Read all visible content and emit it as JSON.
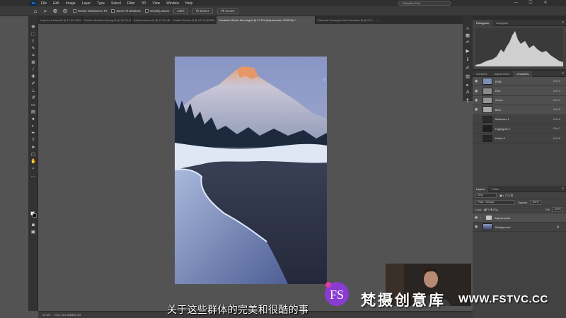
{
  "menubar": {
    "logo": "Ps",
    "items": [
      "File",
      "Edit",
      "Image",
      "Layer",
      "Type",
      "Select",
      "Filter",
      "3D",
      "View",
      "Window",
      "Help"
    ],
    "search_label": "Selection Tool",
    "min": "—",
    "max": "☐",
    "close": "✕"
  },
  "optionsbar": {
    "resize_windows": "Resize Windows to Fit",
    "zoom_all": "Zoom All Windows",
    "scrubby_zoom": "Scrubby Zoom",
    "zoom_100": "100%",
    "fit_screen": "Fit Screen",
    "fill_screen": "Fill Screen"
  },
  "tabs": [
    {
      "label": "Lupines Iceland.tif @ 12.5% (RGB/...",
      "close": "×"
    },
    {
      "label": "Golden Northern Spring.tif @ 16.7% (RGB...",
      "close": "×"
    },
    {
      "label": "Iceland Aurora.tif @ 12.5% (RGB/...",
      "close": "×"
    },
    {
      "label": "Dotted Sunset.tif @ 16.7% (RGB/...",
      "close": "×"
    },
    {
      "label": "Canadian Winter Morning.tif @ 12.5% (Adjustments, RGB/16) *",
      "close": "×"
    },
    {
      "label": "Dramatic Evening in the Dolomites.tif @ 12.5...",
      "close": "×"
    }
  ],
  "histogram_panel": {
    "tabs": [
      "Histogram",
      "Navigator"
    ]
  },
  "channels_panel": {
    "tabs": [
      "Libraries",
      "Adjustments",
      "Channels"
    ],
    "rows": [
      {
        "name": "RGB",
        "key": "Ctrl+2"
      },
      {
        "name": "Red",
        "key": "Ctrl+3"
      },
      {
        "name": "Green",
        "key": "Ctrl+4"
      },
      {
        "name": "Blue",
        "key": "Ctrl+5"
      },
      {
        "name": "Midtones 1",
        "key": "Ctrl+6"
      },
      {
        "name": "Highlights 4",
        "key": "Ctrl+7"
      },
      {
        "name": "Darks 5",
        "key": "Ctrl+8"
      }
    ]
  },
  "layers_panel": {
    "tabs": [
      "Layers",
      "Paths"
    ],
    "kind": "Kind",
    "blend_mode": "Pass Through",
    "opacity_label": "Opacity:",
    "opacity_value": "100%",
    "lock_label": "Lock:",
    "fill_label": "Fill:",
    "fill_value": "100%",
    "layers": [
      {
        "name": "Adjustments"
      },
      {
        "name": "Background"
      }
    ]
  },
  "statusbar": {
    "zoom": "12.5%",
    "doc": "Doc: 181.4M/881.7M"
  },
  "overlay": {
    "subtitle": "关于这些群体的完美和很酷的事",
    "watermark_logo": "FS",
    "watermark_text": "梵摄创意库",
    "watermark_url": "WWW.FSTVC.CC"
  }
}
